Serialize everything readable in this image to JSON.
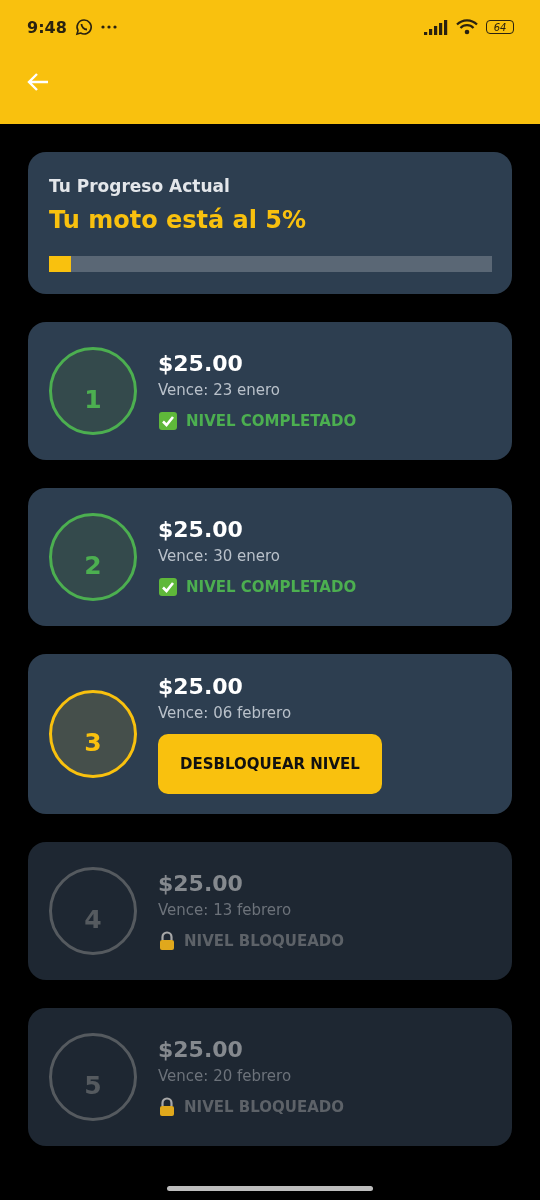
{
  "status_bar": {
    "time": "9:48",
    "battery": "64"
  },
  "progress": {
    "label": "Tu Progreso Actual",
    "headline": "Tu moto está al 5%",
    "level": 0.05
  },
  "levels": [
    {
      "number": "1",
      "amount": "$25.00",
      "due": "Vence: 23 enero",
      "kind": "completed",
      "status": "NIVEL COMPLETADO"
    },
    {
      "number": "2",
      "amount": "$25.00",
      "due": "Vence: 30 enero",
      "kind": "completed",
      "status": "NIVEL COMPLETADO"
    },
    {
      "number": "3",
      "amount": "$25.00",
      "due": "Vence: 06 febrero",
      "kind": "current",
      "action": "DESBLOQUEAR NIVEL"
    },
    {
      "number": "4",
      "amount": "$25.00",
      "due": "Vence: 13 febrero",
      "kind": "locked",
      "status": "NIVEL BLOQUEADO"
    },
    {
      "number": "5",
      "amount": "$25.00",
      "due": "Vence: 20 febrero",
      "kind": "locked",
      "status": "NIVEL BLOQUEADO"
    }
  ]
}
